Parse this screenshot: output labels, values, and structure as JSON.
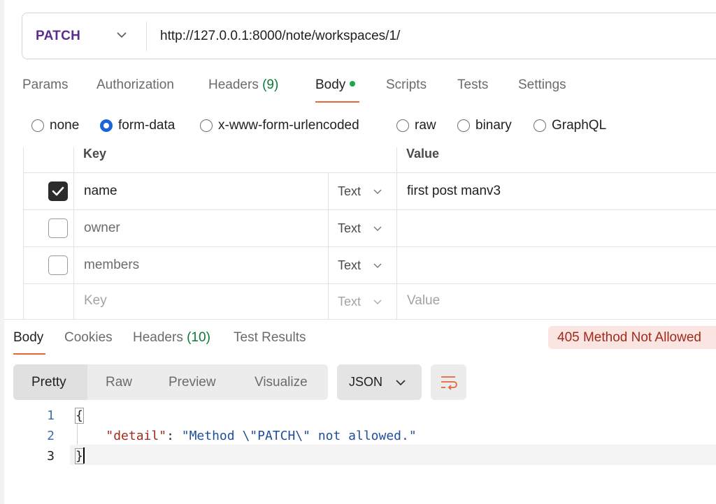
{
  "request": {
    "method": "PATCH",
    "url": "http://127.0.0.1:8000/note/workspaces/1/"
  },
  "request_tabs": [
    {
      "label": "Params"
    },
    {
      "label": "Authorization"
    },
    {
      "label": "Headers",
      "count": "(9)"
    },
    {
      "label": "Body",
      "active": true
    },
    {
      "label": "Scripts"
    },
    {
      "label": "Tests"
    },
    {
      "label": "Settings"
    }
  ],
  "body_types": [
    {
      "label": "none",
      "selected": false
    },
    {
      "label": "form-data",
      "selected": true
    },
    {
      "label": "x-www-form-urlencoded",
      "selected": false
    },
    {
      "label": "raw",
      "selected": false
    },
    {
      "label": "binary",
      "selected": false
    },
    {
      "label": "GraphQL",
      "selected": false
    }
  ],
  "form_table": {
    "headers": {
      "key": "Key",
      "value": "Value"
    },
    "rows": [
      {
        "checked": true,
        "key": "name",
        "type": "Text",
        "value": "first post manv3"
      },
      {
        "checked": false,
        "key": "owner",
        "type": "Text",
        "value": ""
      },
      {
        "checked": false,
        "key": "members",
        "type": "Text",
        "value": ""
      }
    ],
    "empty_row": {
      "key_placeholder": "Key",
      "type": "Text",
      "value_placeholder": "Value"
    }
  },
  "response_tabs": [
    {
      "label": "Body",
      "active": true
    },
    {
      "label": "Cookies"
    },
    {
      "label": "Headers",
      "count": "(10)"
    },
    {
      "label": "Test Results"
    }
  ],
  "status": "405 Method Not Allowed",
  "view_modes": [
    "Pretty",
    "Raw",
    "Preview",
    "Visualize"
  ],
  "format": "JSON",
  "code": {
    "line_numbers": [
      "1",
      "2",
      "3"
    ],
    "open": "{",
    "key": "\"detail\"",
    "colon": ": ",
    "string": "\"Method \\\"PATCH\\\" not allowed.\"",
    "close": "}"
  },
  "colors": {
    "method": "#5b2d91",
    "accent": "#e8643b",
    "radio_selected": "#1d63d9",
    "status_text": "#9e2a1a",
    "status_bg": "#fbe5e2",
    "count_green": "#0a7a36"
  },
  "icons": {
    "method_dropdown": "chevron-down-icon",
    "type_dropdown": "chevron-down-icon",
    "format_dropdown": "chevron-down-icon",
    "wrap": "wrap-lines-icon",
    "checkbox": "checkmark-icon"
  }
}
